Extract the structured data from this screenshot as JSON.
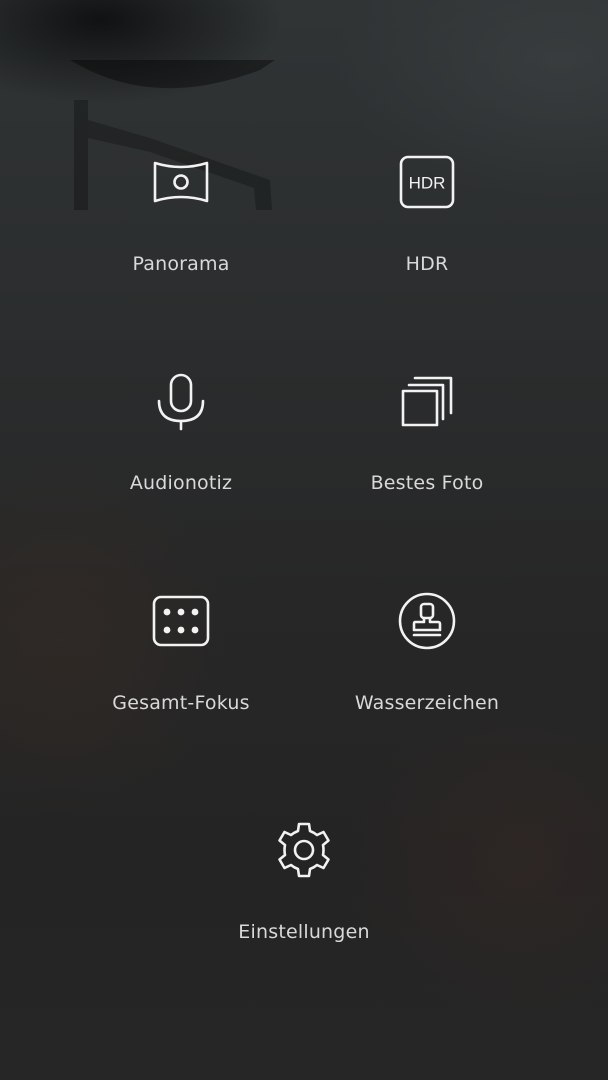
{
  "menu": {
    "items": [
      {
        "label": "Panorama",
        "icon": "panorama-icon"
      },
      {
        "label": "HDR",
        "icon": "hdr-icon",
        "icon_text": "HDR"
      },
      {
        "label": "Audionotiz",
        "icon": "microphone-icon"
      },
      {
        "label": "Bestes Foto",
        "icon": "stacked-photos-icon"
      },
      {
        "label": "Gesamt-Fokus",
        "icon": "dot-grid-icon"
      },
      {
        "label": "Wasserzeichen",
        "icon": "stamp-icon"
      },
      {
        "label": "Einstellungen",
        "icon": "gear-icon"
      }
    ]
  },
  "colors": {
    "icon": "#f2f2f2",
    "label": "#d9d9d9",
    "background": "#2a2b2c"
  }
}
